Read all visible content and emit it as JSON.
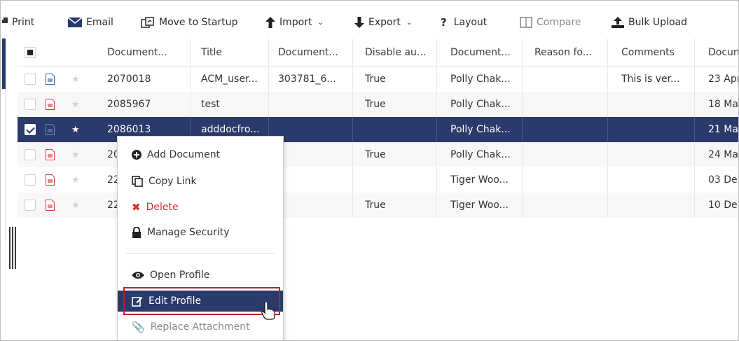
{
  "toolbar": {
    "print": "Print",
    "email": "Email",
    "move_to_startup": "Move to Startup",
    "import": "Import",
    "export": "Export",
    "layout": "Layout",
    "compare": "Compare",
    "bulk_upload": "Bulk Upload"
  },
  "grid": {
    "columns": [
      "Document...",
      "Title",
      "Document...",
      "Disable au...",
      "Document...",
      "Reason fo...",
      "Comments",
      "Docun"
    ],
    "rows": [
      {
        "type": "word",
        "starred": false,
        "selected": false,
        "cells": [
          "2070018",
          "ACM_user...",
          "303781_6...",
          "True",
          "Polly Chak...",
          "",
          "This is ver...",
          "23 Apı"
        ]
      },
      {
        "type": "pdf",
        "starred": false,
        "selected": false,
        "cells": [
          "2085967",
          "test",
          "",
          "True",
          "Polly Chak...",
          "",
          "",
          "18 Ma"
        ]
      },
      {
        "type": "word",
        "starred": true,
        "selected": true,
        "cells": [
          "2086013",
          "adddocfro...",
          "",
          "",
          "Polly Chak...",
          "",
          "",
          "21 Ma"
        ]
      },
      {
        "type": "pdf",
        "starred": false,
        "selected": false,
        "cells": [
          "20",
          "",
          "",
          "True",
          "Polly Chak...",
          "",
          "",
          "24 Ma"
        ]
      },
      {
        "type": "pdf",
        "starred": false,
        "selected": false,
        "cells": [
          "22",
          "",
          "",
          "",
          "Tiger Woo...",
          "",
          "",
          "03 Dei"
        ]
      },
      {
        "type": "pdf",
        "starred": false,
        "selected": false,
        "cells": [
          "22",
          "",
          "",
          "True",
          "Tiger Woo...",
          "",
          "",
          "10 Dei"
        ]
      }
    ]
  },
  "menu": {
    "add_document": "Add Document",
    "copy_link": "Copy Link",
    "delete": "Delete",
    "manage_security": "Manage Security",
    "open_profile": "Open Profile",
    "edit_profile": "Edit Profile",
    "replace_attachment": "Replace Attachment"
  },
  "colors": {
    "selected_row": "#2a3a6a",
    "delete_red": "#d03030",
    "highlight_border": "#c01c28"
  }
}
